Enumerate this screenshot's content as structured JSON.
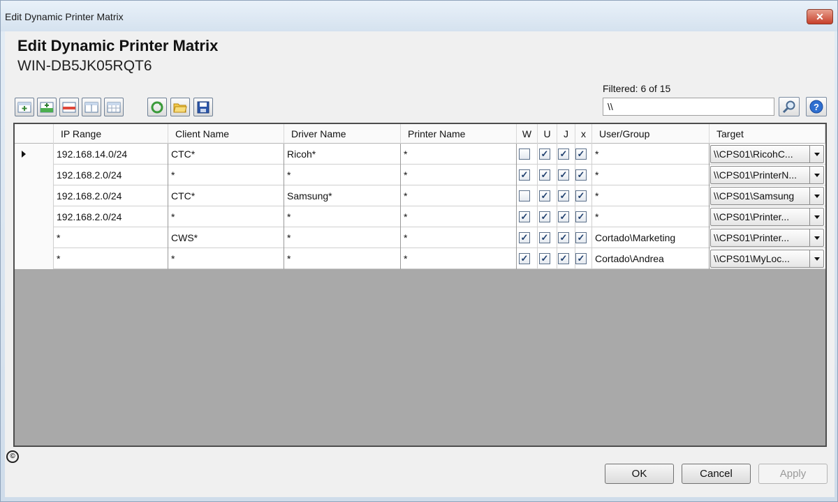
{
  "window": {
    "title": "Edit Dynamic Printer Matrix",
    "close_glyph": "✕"
  },
  "header": {
    "title": "Edit Dynamic Printer Matrix",
    "server": "WIN-DB5JK05RQT6"
  },
  "toolbar": {
    "buttons": [
      "add-row-icon",
      "add-row-green-icon",
      "delete-row-icon",
      "edit-row-icon",
      "table-icon",
      "refresh-icon",
      "open-folder-icon",
      "save-icon"
    ]
  },
  "filter": {
    "status": "Filtered: 6 of 15",
    "value": "\\\\",
    "search_icon": "magnifier-icon",
    "help_icon": "help-icon"
  },
  "grid": {
    "columns": [
      "IP Range",
      "Client Name",
      "Driver Name",
      "Printer Name",
      "W",
      "U",
      "J",
      "x",
      "User/Group",
      "Target"
    ],
    "rows": [
      {
        "ip": "192.168.14.0/24",
        "client": "CTC*",
        "driver": "Ricoh*",
        "printer": "*",
        "w": false,
        "u": true,
        "j": true,
        "x": true,
        "user": "*",
        "target": "\\\\CPS01\\RicohC...",
        "current": true
      },
      {
        "ip": "192.168.2.0/24",
        "client": "*",
        "driver": "*",
        "printer": "*",
        "w": true,
        "u": true,
        "j": true,
        "x": true,
        "user": "*",
        "target": "\\\\CPS01\\PrinterN...",
        "current": false
      },
      {
        "ip": "192.168.2.0/24",
        "client": "CTC*",
        "driver": "Samsung*",
        "printer": "*",
        "w": false,
        "u": true,
        "j": true,
        "x": true,
        "user": "*",
        "target": "\\\\CPS01\\Samsung",
        "current": false
      },
      {
        "ip": "192.168.2.0/24",
        "client": "*",
        "driver": "*",
        "printer": "*",
        "w": true,
        "u": true,
        "j": true,
        "x": true,
        "user": "*",
        "target": "\\\\CPS01\\Printer...",
        "current": false
      },
      {
        "ip": "*",
        "client": "CWS*",
        "driver": "*",
        "printer": "*",
        "w": true,
        "u": true,
        "j": true,
        "x": true,
        "user": "Cortado\\Marketing",
        "target": "\\\\CPS01\\Printer...",
        "current": false
      },
      {
        "ip": "*",
        "client": "*",
        "driver": "*",
        "printer": "*",
        "w": true,
        "u": true,
        "j": true,
        "x": true,
        "user": "Cortado\\Andrea",
        "target": "\\\\CPS01\\MyLoc...",
        "current": false
      }
    ],
    "check_glyph": "✓"
  },
  "footer": {
    "ok": "OK",
    "cancel": "Cancel",
    "apply": "Apply",
    "copyright_glyph": "©"
  },
  "colors": {
    "grid_empty": "#a9a9a9",
    "titlebar": "#d5e2ef",
    "close": "#c7402a"
  }
}
